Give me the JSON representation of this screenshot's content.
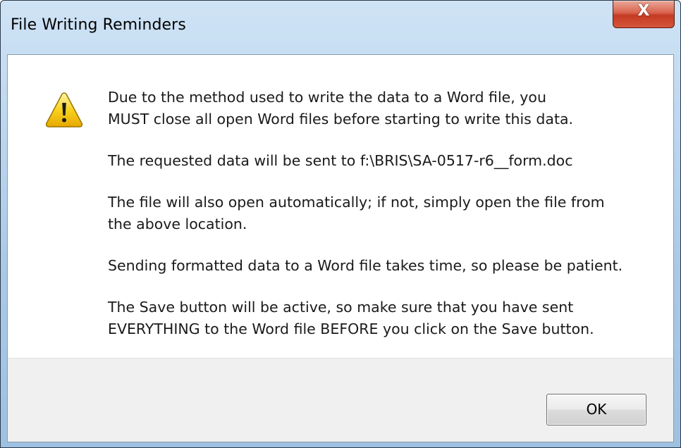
{
  "window": {
    "title": "File Writing Reminders",
    "close_label": "X"
  },
  "icon": {
    "name": "warning-icon"
  },
  "message": {
    "para1": "Due to the method used to write the data to a Word file, you MUST close all open Word files before starting to write this data.",
    "para1_line1": "Due to the method used to write the data to a Word file, you",
    "para1_line2": "MUST close all open Word files before starting to write this data.",
    "para2": "The requested data will be sent to f:\\BRIS\\SA-0517-r6__form.doc",
    "para3_line1": "The file will also open automatically; if not, simply open the file from",
    "para3_line2": "the above location.",
    "para4": "Sending formatted data to a Word file takes time, so please be patient.",
    "para5_line1": "The Save button will be active, so make sure that you have sent",
    "para5_line2": "EVERYTHING to the Word file BEFORE you click on the Save button."
  },
  "buttons": {
    "ok_label": "OK"
  },
  "colors": {
    "warning_yellow": "#f5c400",
    "close_red": "#c43a22",
    "frame_blue": "#aac9e6"
  }
}
